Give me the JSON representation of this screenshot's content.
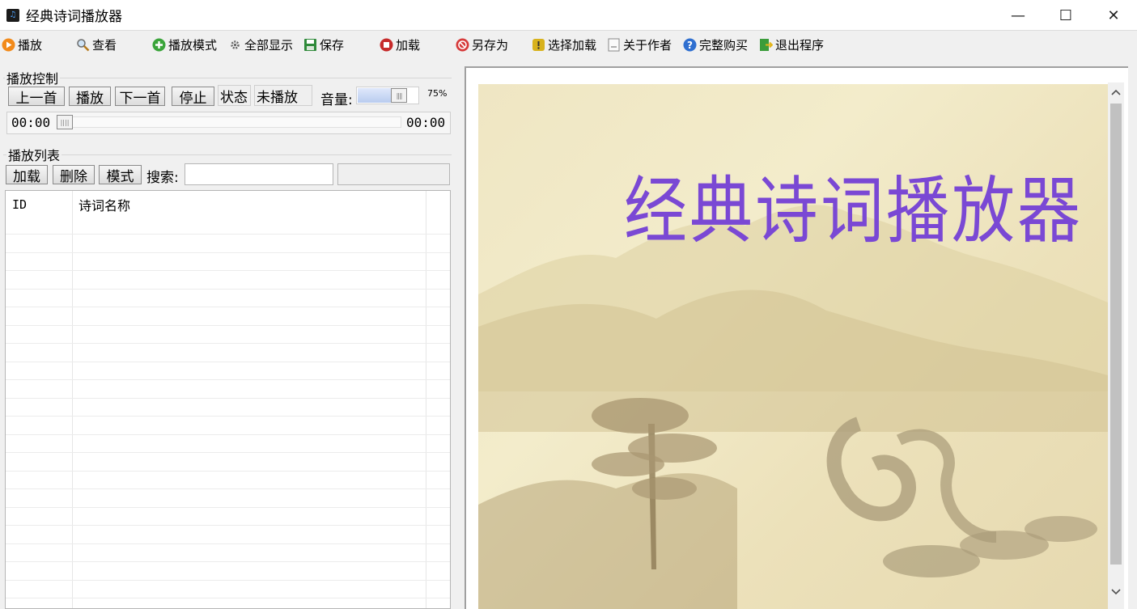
{
  "window": {
    "title": "经典诗词播放器",
    "controls": {
      "minimize": "—",
      "maximize": "☐",
      "close": "✕"
    }
  },
  "toolbar": [
    {
      "label": "播放",
      "icon": "play-icon"
    },
    {
      "label": "查看",
      "icon": "magnifier-icon"
    },
    {
      "label": "播放模式",
      "icon": "plus-circle-icon"
    },
    {
      "label": "全部显示",
      "icon": "gear-icon"
    },
    {
      "label": "保存",
      "icon": "floppy-icon"
    },
    {
      "label": "加载",
      "icon": "stop-circle-icon"
    },
    {
      "label": "另存为",
      "icon": "save-as-icon"
    },
    {
      "label": "选择加载",
      "icon": "select-load-icon"
    },
    {
      "label": "关于作者",
      "icon": "document-icon"
    },
    {
      "label": "完整购买",
      "icon": "help-icon"
    },
    {
      "label": "退出程序",
      "icon": "exit-icon"
    }
  ],
  "playback_control": {
    "group_label": "播放控制",
    "prev": "上一首",
    "play": "播放",
    "next": "下一首",
    "stop": "停止",
    "status_label": "状态",
    "status_value": "未播放",
    "volume_label": "音量:",
    "volume_percent": "75%",
    "volume_level": 0.75,
    "time_current": "00:00",
    "time_total": "00:00",
    "progress": 0
  },
  "playlist": {
    "group_label": "播放列表",
    "load": "加载",
    "delete": "删除",
    "mode": "模式",
    "search_label": "搜索:",
    "search_value": "",
    "columns": [
      "ID",
      "诗词名称"
    ]
  },
  "preview": {
    "title": "经典诗词播放器"
  }
}
